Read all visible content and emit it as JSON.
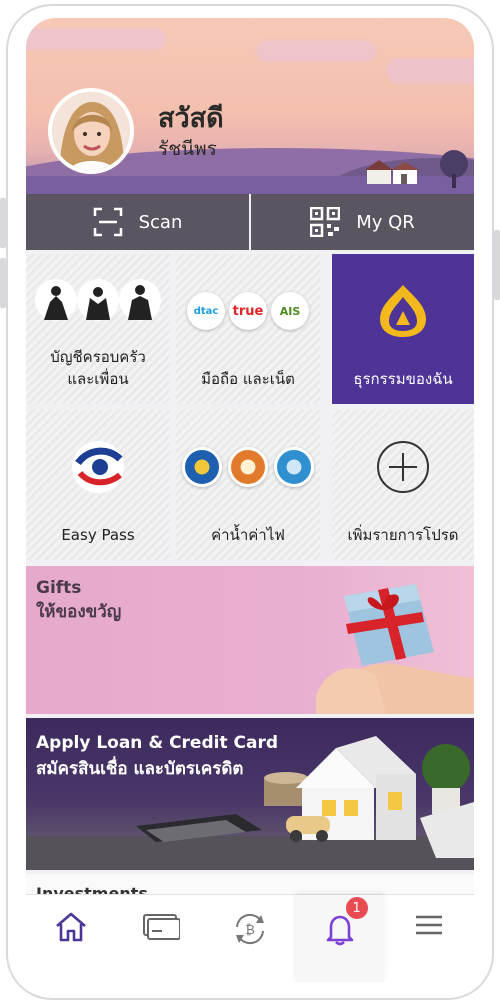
{
  "header": {
    "greeting": "สวัสดี",
    "username": "รัชนีพร"
  },
  "scanbar": {
    "scan_label": "Scan",
    "myqr_label": "My QR"
  },
  "tiles": [
    {
      "label_line1": "บัญชีครอบครัว",
      "label_line2": "และเพื่อน"
    },
    {
      "label_line1": "มือถือ และเน็ต",
      "logos": [
        "dtac",
        "true",
        "AIS"
      ]
    },
    {
      "label_line1": "ธุรกรรมของฉัน"
    },
    {
      "label_line1": "Easy Pass"
    },
    {
      "label_line1": "ค่าน้ำค่าไฟ"
    },
    {
      "label_line1": "เพิ่มรายการโปรด"
    }
  ],
  "banners": {
    "gifts_en": "Gifts",
    "gifts_th": "ให้ของขวัญ",
    "loan_en": "Apply Loan & Credit Card",
    "loan_th": "สมัครสินเชื่อ และบัตรเครดิต",
    "invest_en": "Investments"
  },
  "nav": {
    "notification_count": "1",
    "icons": [
      "home-icon",
      "card-icon",
      "crypto-exchange-icon",
      "bell-icon",
      "menu-icon"
    ]
  },
  "colors": {
    "brand_purple": "#4d3496",
    "scan_bar": "#5a5560",
    "badge_red": "#e84b52",
    "brand_gold": "#f2b81c"
  }
}
